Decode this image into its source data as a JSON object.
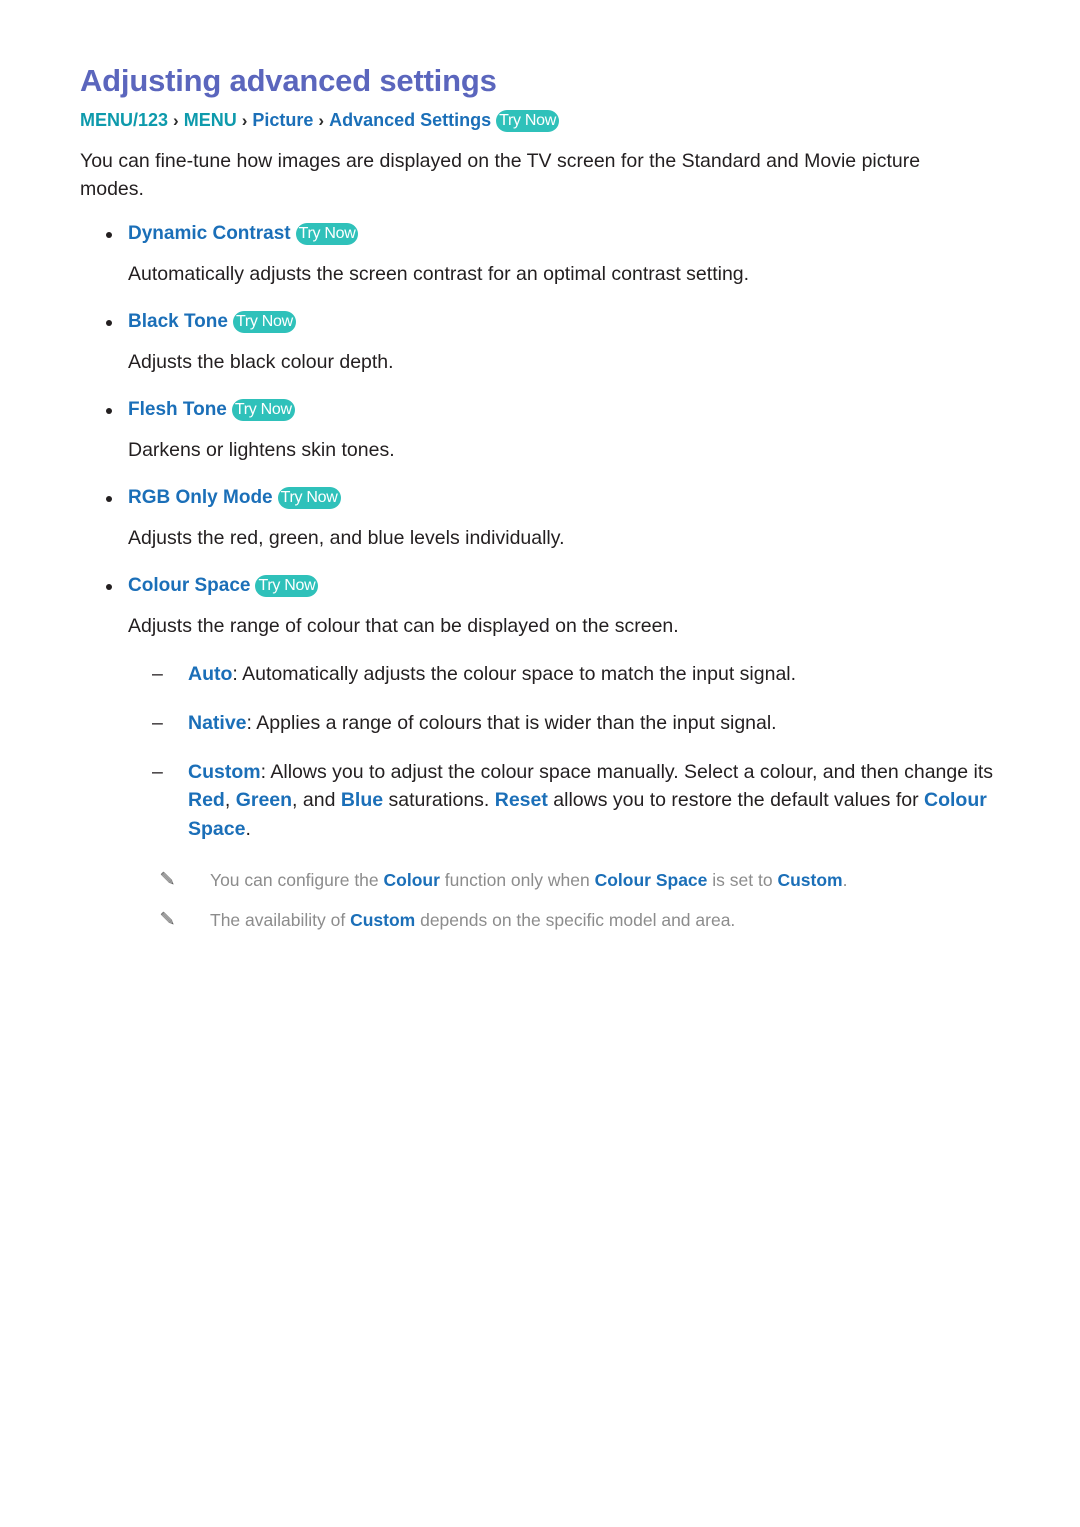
{
  "document": {
    "title": "Adjusting advanced settings",
    "breadcrumb": {
      "items": [
        {
          "label": "MENU/123",
          "style": "teal"
        },
        {
          "label": "MENU",
          "style": "teal"
        },
        {
          "label": "Picture",
          "style": "blue"
        },
        {
          "label": "Advanced Settings",
          "style": "blue"
        }
      ],
      "separator": "›",
      "badge": "Try Now"
    },
    "intro": "You can fine-tune how images are displayed on the TV screen for the Standard and Movie picture modes."
  },
  "badges": {
    "try_now": "Try Now"
  },
  "settings": [
    {
      "label": "Dynamic Contrast",
      "badge": "Try Now",
      "description": "Automatically adjusts the screen contrast for an optimal contrast setting."
    },
    {
      "label": "Black Tone",
      "badge": "Try Now",
      "description": "Adjusts the black colour depth."
    },
    {
      "label": "Flesh Tone",
      "badge": "Try Now",
      "description": "Darkens or lightens skin tones."
    },
    {
      "label": "RGB Only Mode",
      "badge": "Try Now",
      "description": "Adjusts the red, green, and blue levels individually."
    },
    {
      "label": "Colour Space",
      "badge": "Try Now",
      "description": "Adjusts the range of colour that can be displayed on the screen."
    }
  ],
  "colour_space_options": [
    {
      "marker": "–",
      "term": "Auto",
      "text": ": Automatically adjusts the colour space to match the input signal."
    },
    {
      "marker": "–",
      "term": "Native",
      "text": ": Applies a range of colours that is wider than the input signal."
    },
    {
      "marker": "–",
      "term": "Custom",
      "text_parts": {
        "a": ": Allows you to adjust the colour space manually. Select a colour, and then change its ",
        "kw1": "Red",
        "b": ", ",
        "kw2": "Green",
        "c": ", and ",
        "kw3": "Blue",
        "d": " saturations. ",
        "kw4": "Reset",
        "e": " allows you to restore the default values for ",
        "kw5": "Colour Space",
        "f": "."
      }
    }
  ],
  "notes": [
    {
      "icon": "pencil-icon",
      "parts": {
        "a": "You can configure the ",
        "kw1": "Colour",
        "b": " function only when ",
        "kw2": "Colour Space",
        "c": " is set to ",
        "kw3": "Custom",
        "d": "."
      }
    },
    {
      "icon": "pencil-icon",
      "parts": {
        "a": "The availability of ",
        "kw1": "Custom",
        "b": " depends on the specific model and area.",
        "c": "",
        "kw2": "",
        "d": ""
      }
    }
  ],
  "colors": {
    "title": "#5B66BD",
    "teal": "#0E9AAC",
    "blue": "#1B6FB8",
    "badge_bg": "#2FC1BA",
    "body": "#231F20",
    "note": "#8C8C8C"
  }
}
